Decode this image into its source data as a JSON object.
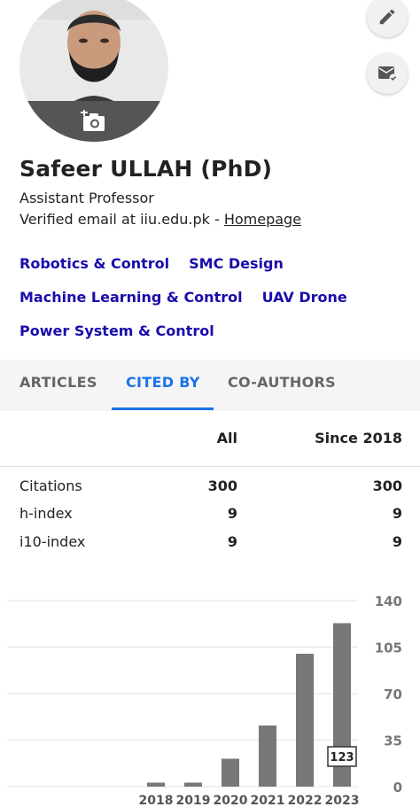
{
  "profile": {
    "name": "Safeer ULLAH (PhD)",
    "position": "Assistant Professor",
    "email_text": "Verified email at iiu.edu.pk - ",
    "homepage_label": "Homepage"
  },
  "interests": [
    [
      "Robotics & Control",
      "SMC Design"
    ],
    [
      "Machine Learning & Control",
      "UAV Drone"
    ],
    [
      "Power System & Control"
    ]
  ],
  "tabs": [
    {
      "label": "ARTICLES",
      "active": false
    },
    {
      "label": "CITED BY",
      "active": true
    },
    {
      "label": "CO-AUTHORS",
      "active": false
    }
  ],
  "stats": {
    "head_all": "All",
    "head_since": "Since 2018",
    "rows": [
      {
        "label": "Citations",
        "all": "300",
        "since": "300"
      },
      {
        "label": "h-index",
        "all": "9",
        "since": "9"
      },
      {
        "label": "i10-index",
        "all": "9",
        "since": "9"
      }
    ]
  },
  "colors": {
    "link": "#1a0dab",
    "tab_active": "#1a73e8",
    "bar": "#777777"
  },
  "icons": [
    "camera-add-icon",
    "pencil-icon",
    "mail-check-icon"
  ],
  "chart_data": {
    "type": "bar",
    "categories": [
      "2018",
      "2019",
      "2020",
      "2021",
      "2022",
      "2023"
    ],
    "values": [
      3,
      3,
      21,
      46,
      100,
      123
    ],
    "ylim": [
      0,
      140
    ],
    "yticks": [
      0,
      35,
      70,
      105,
      140
    ],
    "annotation": {
      "category": "2023",
      "text": "123"
    },
    "grid": true
  }
}
